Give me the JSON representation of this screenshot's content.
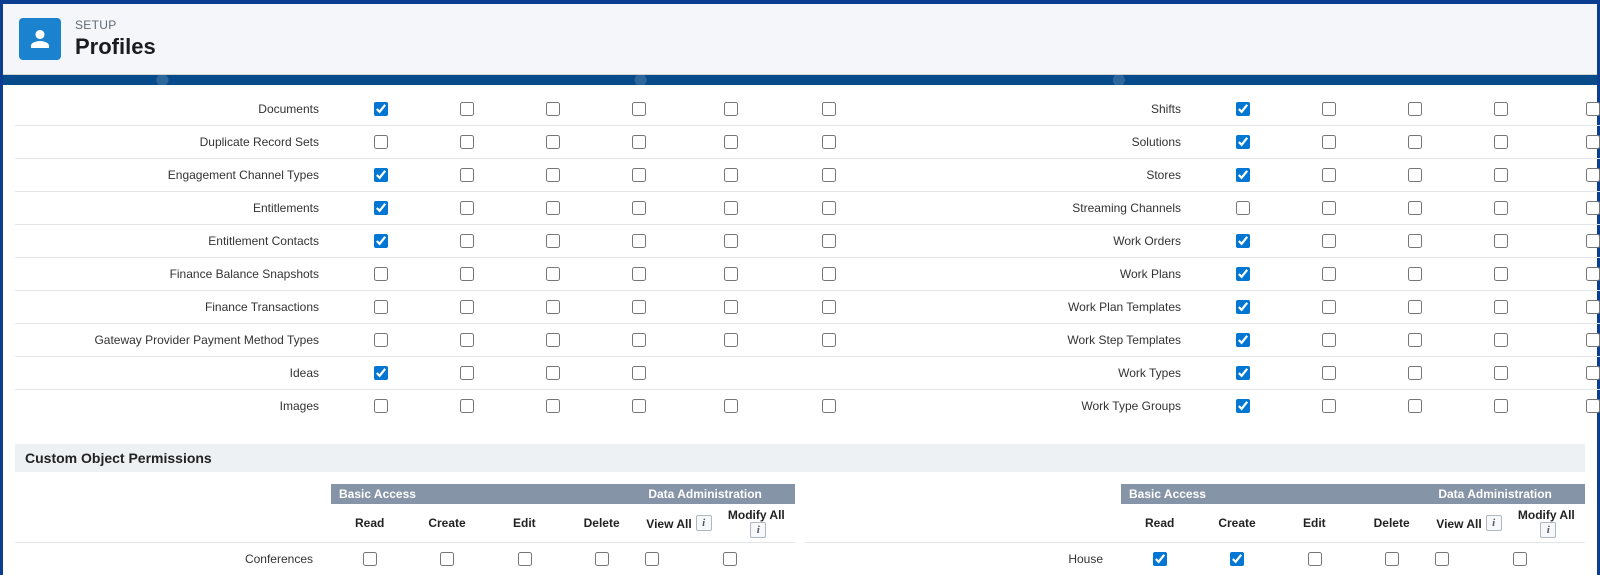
{
  "header": {
    "overline": "SETUP",
    "title": "Profiles"
  },
  "section_custom_title": "Custom Object Permissions",
  "basic_access_label": "Basic Access",
  "data_admin_label": "Data Administration",
  "cols": {
    "read": "Read",
    "create": "Create",
    "edit": "Edit",
    "delete": "Delete",
    "view_all": "View All",
    "modify_all": "Modify All"
  },
  "info_glyph": "i",
  "std_left": [
    {
      "label": "Documents",
      "cells": [
        true,
        false,
        false,
        false,
        false,
        false
      ]
    },
    {
      "label": "Duplicate Record Sets",
      "cells": [
        false,
        false,
        false,
        false,
        false,
        false
      ]
    },
    {
      "label": "Engagement Channel Types",
      "cells": [
        true,
        false,
        false,
        false,
        false,
        false
      ]
    },
    {
      "label": "Entitlements",
      "cells": [
        true,
        false,
        false,
        false,
        false,
        false
      ]
    },
    {
      "label": "Entitlement Contacts",
      "cells": [
        true,
        false,
        false,
        false,
        false,
        false
      ]
    },
    {
      "label": "Finance Balance Snapshots",
      "cells": [
        false,
        false,
        false,
        false,
        false,
        false
      ]
    },
    {
      "label": "Finance Transactions",
      "cells": [
        false,
        false,
        false,
        false,
        false,
        false
      ]
    },
    {
      "label": "Gateway Provider Payment Method Types",
      "cells": [
        false,
        false,
        false,
        false,
        false,
        false
      ]
    },
    {
      "label": "Ideas",
      "cells": [
        true,
        false,
        false,
        false,
        null,
        null
      ]
    },
    {
      "label": "Images",
      "cells": [
        false,
        false,
        false,
        false,
        false,
        false
      ]
    }
  ],
  "std_right": [
    {
      "label": "Shifts",
      "cells": [
        true,
        false,
        false,
        false,
        false,
        false
      ]
    },
    {
      "label": "Solutions",
      "cells": [
        true,
        false,
        false,
        false,
        false,
        false
      ]
    },
    {
      "label": "Stores",
      "cells": [
        true,
        false,
        false,
        false,
        false,
        false
      ]
    },
    {
      "label": "Streaming Channels",
      "cells": [
        false,
        false,
        false,
        false,
        false,
        false
      ]
    },
    {
      "label": "Work Orders",
      "cells": [
        true,
        false,
        false,
        false,
        false,
        false
      ]
    },
    {
      "label": "Work Plans",
      "cells": [
        true,
        false,
        false,
        false,
        false,
        false
      ]
    },
    {
      "label": "Work Plan Templates",
      "cells": [
        true,
        false,
        false,
        false,
        false,
        false
      ]
    },
    {
      "label": "Work Step Templates",
      "cells": [
        true,
        false,
        false,
        false,
        false,
        false
      ]
    },
    {
      "label": "Work Types",
      "cells": [
        true,
        false,
        false,
        false,
        false,
        false
      ]
    },
    {
      "label": "Work Type Groups",
      "cells": [
        true,
        false,
        false,
        false,
        false,
        false
      ]
    }
  ],
  "custom_left": [
    {
      "label": "Conferences",
      "cells": [
        false,
        false,
        false,
        false,
        false,
        false
      ]
    }
  ],
  "custom_right": [
    {
      "label": "House",
      "cells": [
        true,
        true,
        false,
        false,
        false,
        false
      ]
    }
  ]
}
